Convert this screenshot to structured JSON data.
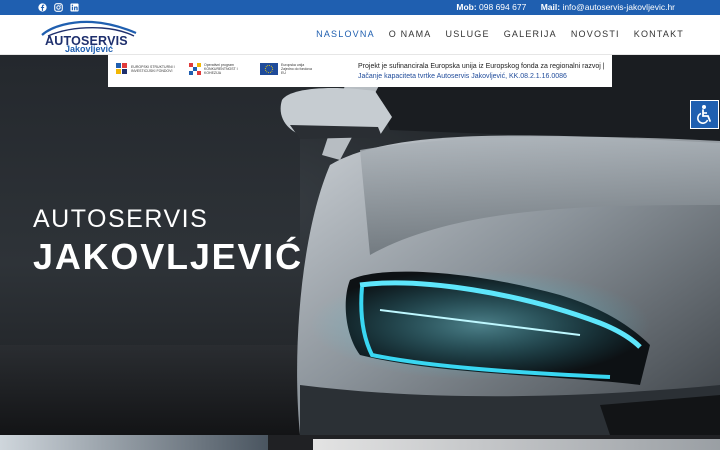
{
  "topbar": {
    "social": [
      "facebook-icon",
      "instagram-icon",
      "linkedin-icon"
    ],
    "phone_label": "Mob:",
    "phone": "098 694 677",
    "mail_label": "Mail:",
    "mail": "info@autoservis-jakovljevic.hr"
  },
  "logo": {
    "main": "AUTOSERVIS",
    "sub": "Jakovljević"
  },
  "nav": {
    "items": [
      {
        "label": "NASLOVNA",
        "active": true
      },
      {
        "label": "O NAMA",
        "active": false
      },
      {
        "label": "USLUGE",
        "active": false
      },
      {
        "label": "GALERIJA",
        "active": false
      },
      {
        "label": "NOVOSTI",
        "active": false
      },
      {
        "label": "KONTAKT",
        "active": false
      }
    ]
  },
  "eu_banner": {
    "line1": "Projekt je sufinancirala Europska unija iz Europskog fonda za regionalni razvoj |",
    "line2": "Jačanje kapaciteta tvrtke Autoservis Jakovljević, KK.08.2.1.16.0086",
    "logos": [
      {
        "name": "eu-structural-funds-logo",
        "text": "EUROPSKI STRUKTURNI I INVESTICIJSKI FONDOVI"
      },
      {
        "name": "competitiveness-programme-logo",
        "text": "Operativni program KONKURENTNOST I KOHEZIJA"
      },
      {
        "name": "eu-flag-logo",
        "text": "Europska unija Zajedno do fondova EU"
      }
    ]
  },
  "hero": {
    "line1": "AUTOSERVIS",
    "line2": "JAKOVLJEVIĆ"
  },
  "colors": {
    "brand_blue": "#1f5fb0",
    "navy": "#1e2f6d",
    "headlight_cyan": "#39d7f2"
  }
}
